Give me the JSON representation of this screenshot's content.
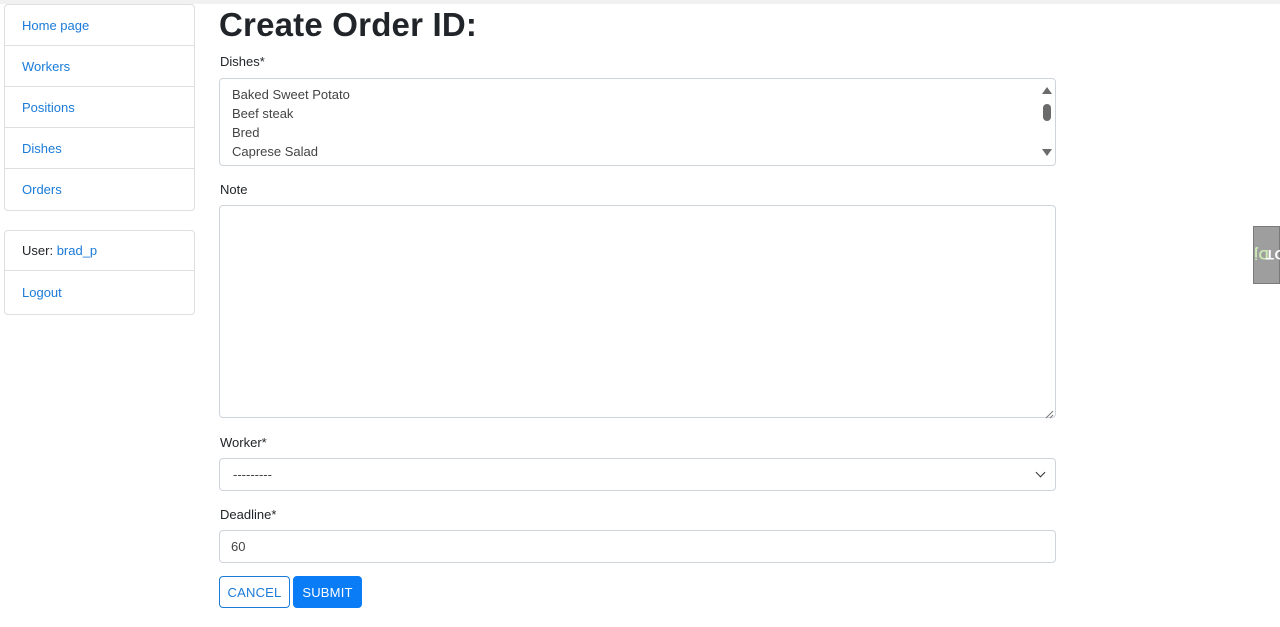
{
  "sidebar": {
    "nav_items": [
      {
        "label": "Home page"
      },
      {
        "label": "Workers"
      },
      {
        "label": "Positions"
      },
      {
        "label": "Dishes"
      },
      {
        "label": "Orders"
      }
    ],
    "user_prefix": "User:",
    "username": "brad_p",
    "logout_label": "Logout"
  },
  "form": {
    "title": "Create Order ID:",
    "dishes_label": "Dishes*",
    "dishes_options": [
      "Baked Sweet Potato",
      "Beef steak",
      "Bred",
      "Caprese Salad"
    ],
    "note_label": "Note",
    "note_value": "",
    "worker_label": "Worker*",
    "worker_selected": "---------",
    "deadline_label": "Deadline*",
    "deadline_value": "60",
    "cancel_label": "CANCEL",
    "submit_label": "SUBMIT"
  },
  "toolbar_handle": {
    "label_prefix": "Dj",
    "label_suffix": "DT"
  },
  "colors": {
    "link": "#1a7bd8",
    "primary": "#0a7cf5",
    "border": "#ced4da"
  },
  "icons": [
    "chevron-down-icon",
    "scroll-up-arrow-icon",
    "scroll-down-arrow-icon",
    "resize-grip-icon"
  ]
}
